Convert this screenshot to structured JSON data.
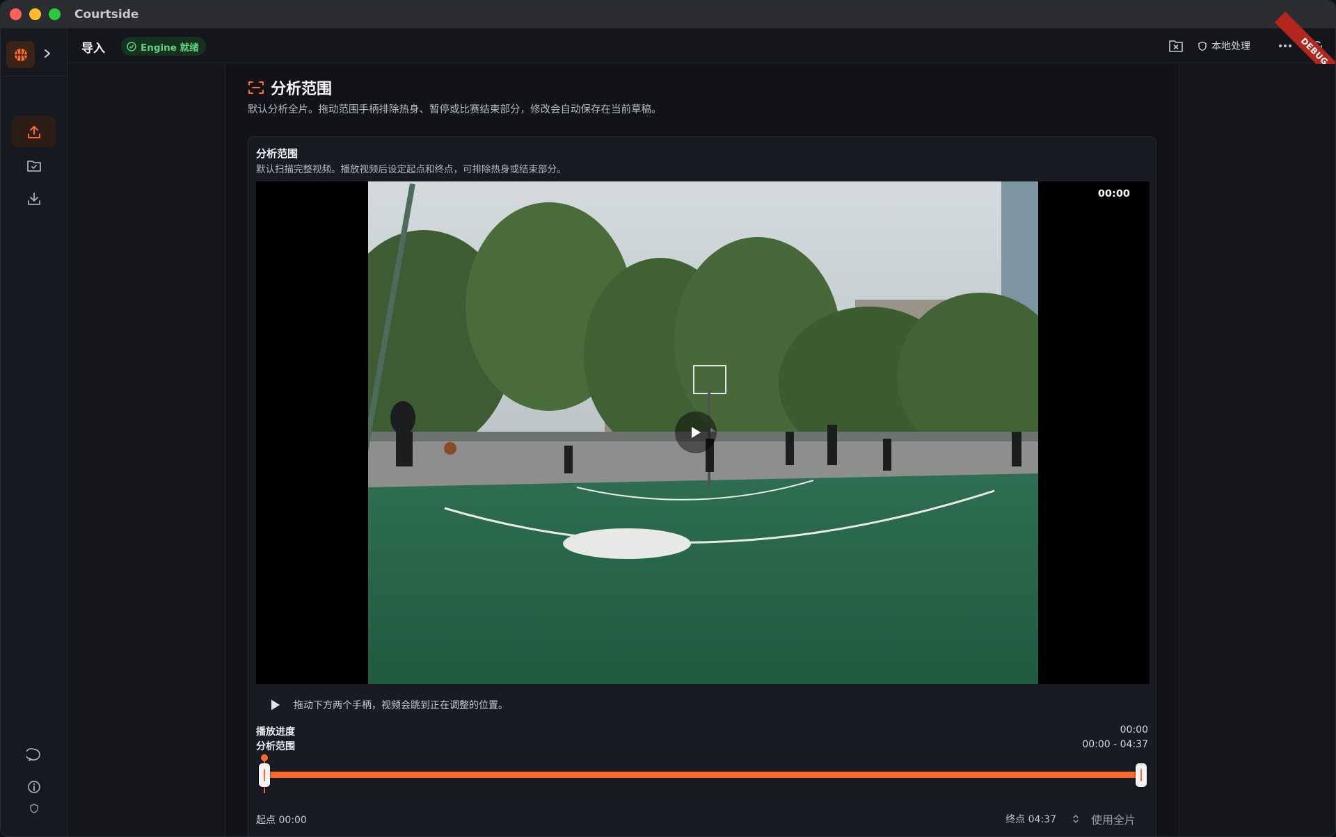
{
  "window": {
    "title": "Courtside"
  },
  "topbar": {
    "crumb": "导入",
    "engine_badge": "Engine 就绪",
    "local_label": "本地处理",
    "debug_label": "DEBUG"
  },
  "section": {
    "title": "分析范围",
    "description": "默认分析全片。拖动范围手柄排除热身、暂停或比赛结束部分，修改会自动保存在当前草稿。"
  },
  "card": {
    "title": "分析范围",
    "description": "默认扫描完整视频。播放视频后设定起点和终点，可排除热身或结束部分。",
    "video_timecode": "00:00",
    "hint": "拖动下方两个手柄，视频会跳到正在调整的位置。",
    "progress_label": "播放进度",
    "progress_value": "00:00",
    "range_label": "分析范围",
    "range_value": "00:00 - 04:37",
    "start_label": "起点 00:00",
    "end_label": "终点 04:37",
    "use_full_label": "使用全片",
    "range_start_fraction": 0.0,
    "range_end_fraction": 1.0,
    "playhead_fraction": 0.0
  },
  "colors": {
    "accent": "#ff6a2b",
    "engine_ok": "#5dd27f",
    "debug": "#b3261e"
  },
  "icons": {
    "logo": "basketball-icon",
    "nav": [
      "home-icon",
      "upload-icon",
      "folder-check-icon",
      "download-icon"
    ],
    "sidebar_bottom": [
      "chat-icon",
      "info-icon",
      "shield-icon"
    ]
  }
}
